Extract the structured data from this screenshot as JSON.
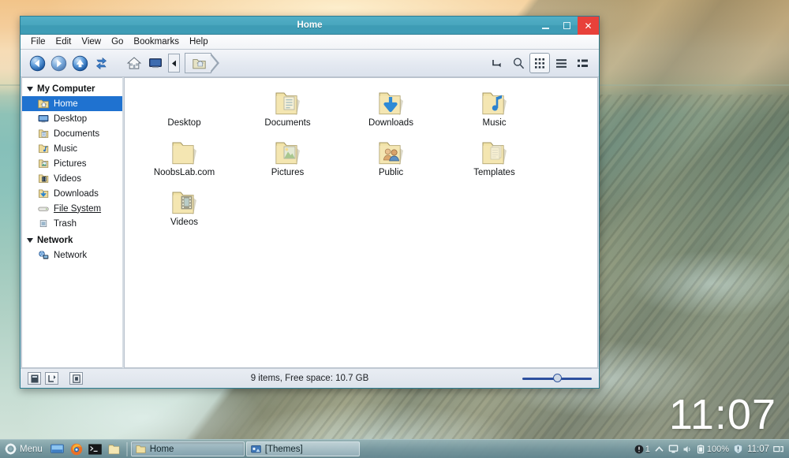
{
  "window": {
    "title": "Home",
    "controls": {
      "minimize": "minimize-button",
      "maximize": "maximize-button",
      "close": "close-button"
    },
    "menubar": [
      "File",
      "Edit",
      "View",
      "Go",
      "Bookmarks",
      "Help"
    ],
    "toolbar": {
      "buttons": [
        "back-icon",
        "forward-icon",
        "up-icon",
        "reload-icon",
        "home-icon",
        "desktop-icon"
      ],
      "path_back_icon": "path-scroll-left-icon",
      "path_crumb": "folder-home-icon",
      "right_buttons": [
        "open-terminal-icon",
        "search-icon",
        "icon-view-icon",
        "list-view-icon",
        "compact-view-icon"
      ],
      "active_view": "icon-view-icon"
    }
  },
  "sidebar": {
    "groups": [
      {
        "label": "My Computer",
        "items": [
          {
            "label": "Home",
            "icon": "home-folder-icon",
            "selected": true,
            "underline": false
          },
          {
            "label": "Desktop",
            "icon": "desktop-folder-icon",
            "selected": false,
            "underline": false
          },
          {
            "label": "Documents",
            "icon": "documents-folder-icon",
            "selected": false,
            "underline": false
          },
          {
            "label": "Music",
            "icon": "music-folder-icon",
            "selected": false,
            "underline": false
          },
          {
            "label": "Pictures",
            "icon": "pictures-folder-icon",
            "selected": false,
            "underline": false
          },
          {
            "label": "Videos",
            "icon": "videos-folder-icon",
            "selected": false,
            "underline": false
          },
          {
            "label": "Downloads",
            "icon": "downloads-folder-icon",
            "selected": false,
            "underline": false
          },
          {
            "label": "File System",
            "icon": "drive-icon",
            "selected": false,
            "underline": true
          },
          {
            "label": "Trash",
            "icon": "trash-icon",
            "selected": false,
            "underline": false
          }
        ]
      },
      {
        "label": "Network",
        "items": [
          {
            "label": "Network",
            "icon": "network-icon",
            "selected": false,
            "underline": false
          }
        ]
      }
    ]
  },
  "files": [
    {
      "label": "Desktop",
      "icon": "blank-icon"
    },
    {
      "label": "Documents",
      "icon": "documents-folder-icon"
    },
    {
      "label": "Downloads",
      "icon": "downloads-folder-icon"
    },
    {
      "label": "Music",
      "icon": "music-folder-icon"
    },
    {
      "label": "NoobsLab.com",
      "icon": "plain-folder-icon"
    },
    {
      "label": "Pictures",
      "icon": "pictures-folder-icon"
    },
    {
      "label": "Public",
      "icon": "public-folder-icon"
    },
    {
      "label": "Templates",
      "icon": "templates-folder-icon"
    },
    {
      "label": "Videos",
      "icon": "videos-folder-icon"
    }
  ],
  "statusbar": {
    "text": "9 items, Free space: 10.7 GB",
    "left_buttons": [
      "statusbar-button-1",
      "statusbar-button-2",
      "statusbar-button-3"
    ],
    "zoom_slider": "zoom-slider"
  },
  "taskbar": {
    "menu_label": "Menu",
    "launchers": [
      "show-desktop-icon",
      "firefox-icon",
      "terminal-icon",
      "file-manager-icon"
    ],
    "tasks": [
      {
        "label": "Home",
        "icon": "folder-icon",
        "active": true
      },
      {
        "label": "[Themes]",
        "icon": "themes-icon",
        "active": false
      }
    ],
    "tray": {
      "updates_count": "1",
      "network_icon": "network-up-icon",
      "display_icon": "display-icon",
      "volume_icon": "volume-icon",
      "battery_label": "100%",
      "shield_icon": "shield-icon",
      "clock": "11:07",
      "workspace_icon": "workspace-switcher-icon"
    }
  },
  "desktop": {
    "clock": "11:07"
  },
  "colors": {
    "titlebar": "#49a6be",
    "close_button": "#e8413a",
    "selection": "#1f72d0",
    "folder_yellow": "#f2dd9a",
    "slider_blue": "#2c4f9e"
  }
}
